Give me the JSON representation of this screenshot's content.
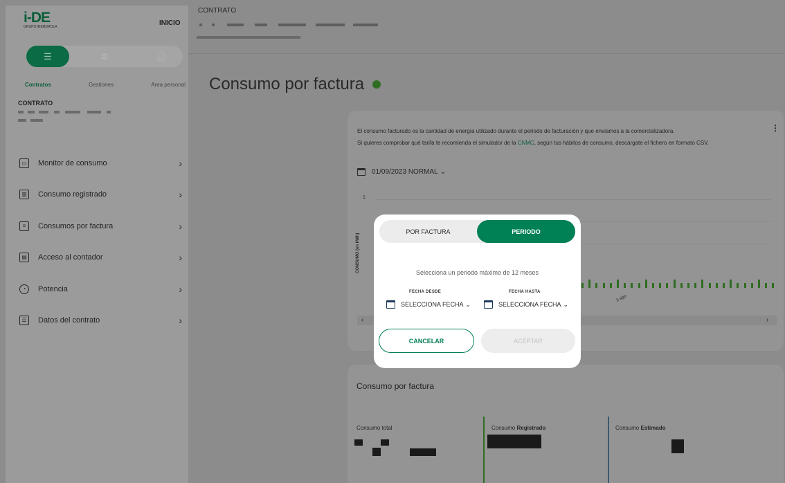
{
  "brand": {
    "logo": "i-DE",
    "subtitle": "GRUPO IBERDROLA"
  },
  "header": {
    "inicio": "INICIO",
    "contract_label": "CONTRATO"
  },
  "sidebar": {
    "tabs": [
      {
        "label": "Contratos",
        "icon": "list-icon",
        "active": true
      },
      {
        "label": "Gestiones",
        "icon": "gear-icon",
        "active": false
      },
      {
        "label": "Area personal",
        "icon": "person-icon",
        "active": false
      }
    ],
    "contract_title": "CONTRATO",
    "menu": [
      {
        "label": "Monitor de consumo",
        "icon": "monitor-icon"
      },
      {
        "label": "Consumo registrado",
        "icon": "bar-chart-icon"
      },
      {
        "label": "Consumos por factura",
        "icon": "invoice-icon"
      },
      {
        "label": "Acceso al contador",
        "icon": "meter-icon"
      },
      {
        "label": "Potencia",
        "icon": "gauge-icon"
      },
      {
        "label": "Datos del contrato",
        "icon": "document-icon"
      }
    ]
  },
  "main": {
    "title": "Consumo por factura",
    "description_1": "El consumo facturado es la cantidad de energía utilizado durante el periodo de facturación y que enviamos a la comercializadora.",
    "description_2_pre": "Si quieres comprobar qué tarifa te recomienda el simulador de la ",
    "description_link": "CNMC",
    "description_2_post": ", según tus hábitos de consumo, descárgate el fichero en formato CSV.",
    "selected_period": "01/09/2023 NORMAL",
    "y_axis_label": "CONSUMO (en kWh)",
    "y_tick": "1",
    "x_tick": "3 ago."
  },
  "summary": {
    "title": "Consumo por factura",
    "total_label": "Consumo total",
    "registrado_pre": "Consumo ",
    "registrado_bold": "Registrado",
    "estimado_pre": "Consumo ",
    "estimado_bold": "Estimado"
  },
  "modal": {
    "tab_factura": "POR FACTURA",
    "tab_periodo": "PERIODO",
    "message": "Selecciona un periodo máximo de 12 meses",
    "desde_label": "FECHA DESDE",
    "hasta_label": "FECHA HASTA",
    "desde_value": "SELECCIONA FECHA",
    "hasta_value": "SELECCIONA FECHA",
    "cancel": "CANCELAR",
    "accept": "ACEPTAR"
  },
  "colors": {
    "primary": "#008055",
    "accent_green": "#2f6d22",
    "overlay": "#8c8c8c"
  }
}
